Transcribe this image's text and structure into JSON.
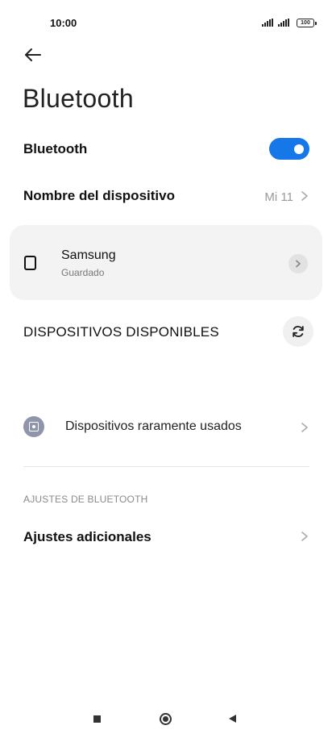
{
  "status_bar": {
    "time": "10:00",
    "battery": "100",
    "signal_icon": "signal-bars-icon",
    "battery_icon": "battery-icon"
  },
  "header": {
    "back_icon": "arrow-left-icon",
    "title": "Bluetooth"
  },
  "bluetooth_toggle": {
    "label": "Bluetooth",
    "on": true,
    "accent_color": "#1677e8"
  },
  "device_name_row": {
    "label": "Nombre del dispositivo",
    "value": "Mi 11"
  },
  "paired_devices": [
    {
      "name": "Samsung",
      "status": "Guardado",
      "icon": "phone-icon"
    }
  ],
  "available_devices": {
    "heading": "DISPOSITIVOS DISPONIBLES",
    "refresh_icon": "refresh-icon"
  },
  "rarely_used": {
    "label": "Dispositivos raramente usados",
    "icon": "device-box-icon"
  },
  "settings_section": {
    "heading": "AJUSTES DE BLUETOOTH",
    "items": [
      {
        "label": "Ajustes adicionales"
      }
    ]
  },
  "nav_bar": {
    "recents_icon": "square-icon",
    "home_icon": "home-circle-icon",
    "back_icon": "triangle-back-icon"
  }
}
